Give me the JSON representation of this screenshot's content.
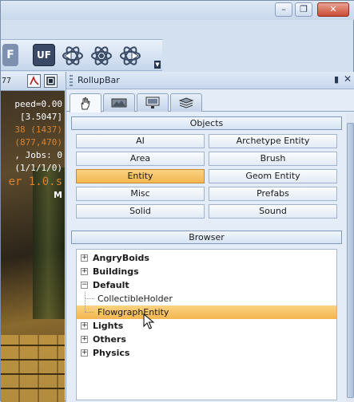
{
  "viewport": {
    "counter": "77",
    "stats": [
      {
        "text": "peed=0.00",
        "color": "#ffffff"
      },
      {
        "text": "[3.5047]",
        "color": "#ffffff"
      },
      {
        "text": "38 (1437)",
        "color": "#d8822e"
      },
      {
        "text": "(877,470)",
        "color": "#d8822e"
      },
      {
        "text": ", Jobs: 0",
        "color": "#ffffff"
      },
      {
        "text": "(1/1/1/0)",
        "color": "#ffffff"
      },
      {
        "text": "er 1.0.s",
        "color": "#d8822e"
      },
      {
        "text": "M",
        "color": "#ffffff"
      }
    ]
  },
  "toolbar": {
    "f_label": "F",
    "uf_label": "UF"
  },
  "rollup": {
    "title": "RollupBar",
    "tabs": [
      {
        "icon": "hand-icon",
        "active": true
      },
      {
        "icon": "terrain-icon",
        "active": false
      },
      {
        "icon": "monitor-icon",
        "active": false
      },
      {
        "icon": "layers-icon",
        "active": false
      }
    ],
    "objects_header": "Objects",
    "objects": [
      {
        "label": "AI",
        "selected": false
      },
      {
        "label": "Archetype Entity",
        "selected": false
      },
      {
        "label": "Area",
        "selected": false
      },
      {
        "label": "Brush",
        "selected": false
      },
      {
        "label": "Entity",
        "selected": true
      },
      {
        "label": "Geom Entity",
        "selected": false
      },
      {
        "label": "Misc",
        "selected": false
      },
      {
        "label": "Prefabs",
        "selected": false
      },
      {
        "label": "Solid",
        "selected": false
      },
      {
        "label": "Sound",
        "selected": false
      }
    ],
    "browser_header": "Browser",
    "tree": [
      {
        "label": "AngryBoids",
        "type": "folder",
        "expanded": false
      },
      {
        "label": "Buildings",
        "type": "folder",
        "expanded": false
      },
      {
        "label": "Default",
        "type": "folder",
        "expanded": true
      },
      {
        "label": "CollectibleHolder",
        "type": "leaf",
        "selected": false
      },
      {
        "label": "FlowgraphEntity",
        "type": "leaf",
        "selected": true
      },
      {
        "label": "Lights",
        "type": "folder",
        "expanded": false
      },
      {
        "label": "Others",
        "type": "folder",
        "expanded": false
      },
      {
        "label": "Physics",
        "type": "folder",
        "expanded": false
      }
    ]
  },
  "colors": {
    "selection": "#f3b550",
    "panel_bg": "#e4ecf7",
    "header_border": "#7f9ac0"
  }
}
